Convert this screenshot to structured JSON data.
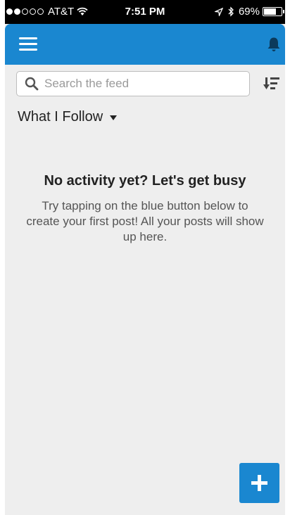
{
  "status_bar": {
    "carrier": "AT&T",
    "time": "7:51 PM",
    "battery_percent": "69%",
    "signal_bars_filled": 2,
    "signal_bars_total": 5,
    "battery_level": 0.69
  },
  "app_bar": {
    "menu_icon": "hamburger-menu-icon",
    "notification_icon": "bell-icon",
    "color": "#1a87d0"
  },
  "search": {
    "placeholder": "Search the feed",
    "value": ""
  },
  "feed_filter": {
    "label": "What I Follow"
  },
  "empty_state": {
    "title": "No activity yet? Let's get busy",
    "message": "Try tapping on the blue button below to create your first post! All your posts will show up here."
  },
  "fab": {
    "icon": "plus-icon"
  }
}
